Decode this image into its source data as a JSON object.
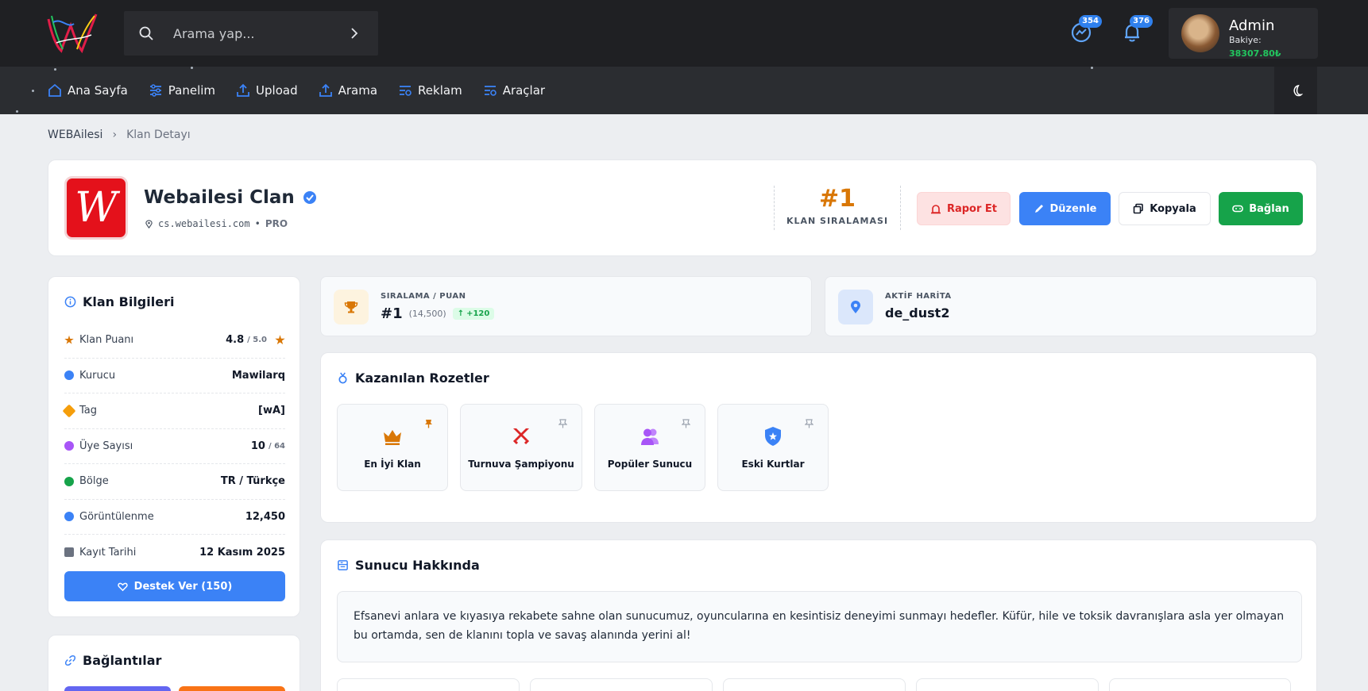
{
  "topbar": {
    "search_placeholder": "Arama yap...",
    "messages_count": "354",
    "notifications_count": "376",
    "user": {
      "name": "Admin",
      "balance_label": "Bakiye:",
      "balance_value": "38307.80₺"
    }
  },
  "nav": {
    "items": [
      {
        "label": "Ana Sayfa",
        "icon": "home-icon"
      },
      {
        "label": "Panelim",
        "icon": "sliders-icon"
      },
      {
        "label": "Upload",
        "icon": "upload-icon"
      },
      {
        "label": "Arama",
        "icon": "upload-icon"
      },
      {
        "label": "Reklam",
        "icon": "list-settings-icon"
      },
      {
        "label": "Araçlar",
        "icon": "list-settings-icon"
      }
    ],
    "theme_toggle_icon": "moon-icon"
  },
  "breadcrumb": {
    "root": "WEBAilesi",
    "current": "Klan Detayı"
  },
  "clan": {
    "logo_letter": "W",
    "name": "Webailesi Clan",
    "server": "cs.webailesi.com",
    "tier": "PRO",
    "rank": "#1",
    "rank_label": "KLAN SIRALAMASI",
    "actions": {
      "report": "Rapor Et",
      "edit": "Düzenle",
      "copy": "Kopyala",
      "connect": "Bağlan"
    }
  },
  "info": {
    "title": "Klan Bilgileri",
    "rows": [
      {
        "key": "Klan Puanı",
        "value": "4.8",
        "sub": "/ 5.0"
      },
      {
        "key": "Kurucu",
        "value": "Mawilarq"
      },
      {
        "key": "Tag",
        "value": "[wA]"
      },
      {
        "key": "Üye Sayısı",
        "value": "10",
        "sub": "/ 64"
      },
      {
        "key": "Bölge",
        "value": "TR / Türkçe"
      },
      {
        "key": "Görüntülenme",
        "value": "12,450"
      },
      {
        "key": "Kayıt Tarihi",
        "value": "12 Kasım 2025"
      }
    ],
    "support_button": "Destek Ver (150)"
  },
  "links": {
    "title": "Bağlantılar"
  },
  "stats": {
    "ranking": {
      "label": "SIRALAMA / PUAN",
      "rank": "#1",
      "points": "(14,500)",
      "delta": "+120"
    },
    "map": {
      "label": "AKTİF HARİTA",
      "value": "de_dust2"
    }
  },
  "badges": {
    "title": "Kazanılan Rozetler",
    "items": [
      {
        "label": "En İyi Klan",
        "icon": "crown-icon",
        "color": "#d97706",
        "pinned": true
      },
      {
        "label": "Turnuva Şampiyonu",
        "icon": "swords-icon",
        "color": "#dc2626",
        "pinned": false
      },
      {
        "label": "Popüler Sunucu",
        "icon": "users-icon",
        "color": "#a855f7",
        "pinned": false
      },
      {
        "label": "Eski Kurtlar",
        "icon": "shield-star-icon",
        "color": "#3b82f6",
        "pinned": false
      }
    ]
  },
  "about": {
    "title": "Sunucu Hakkında",
    "text": "Efsanevi anlara ve kıyasıya rekabete sahne olan sunucumuz, oyuncularına en kesintisiz deneyimi sunmayı hedefler. Küfür, hile ve toksik davranışlara asla yer olmayan bu ortamda, sen de klanını topla ve savaş alanında yerini al!"
  },
  "colors": {
    "accent": "#3b82f6",
    "success": "#16a34a",
    "danger": "#dc2626",
    "gold": "#d97706",
    "topbar": "#1f2023"
  }
}
